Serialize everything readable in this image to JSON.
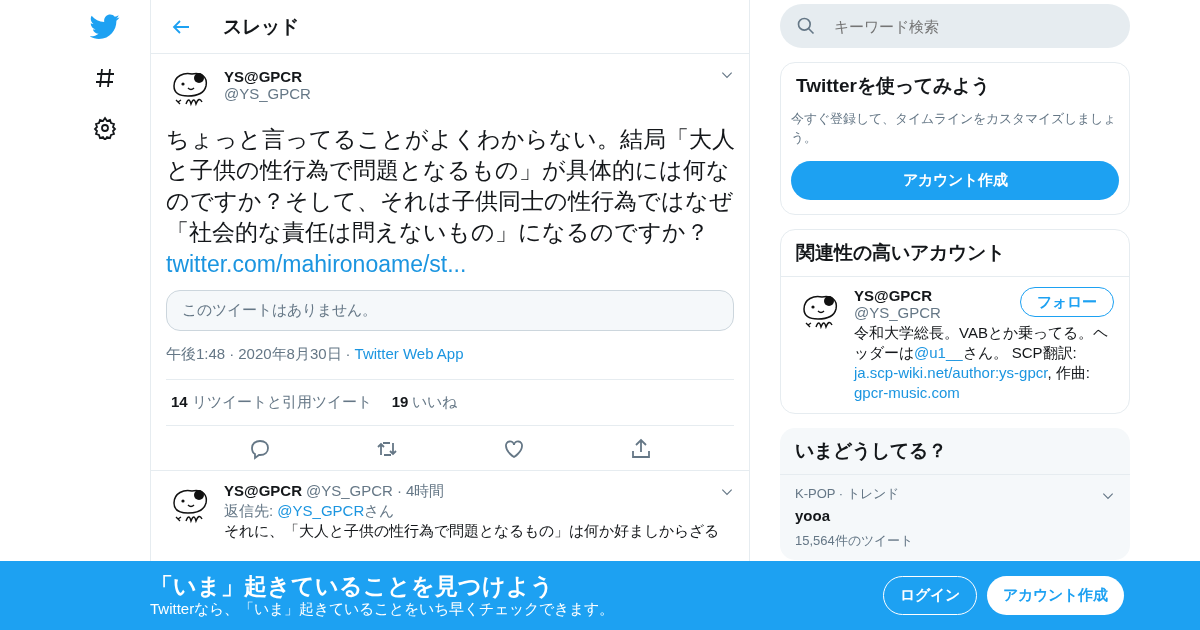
{
  "header": {
    "title": "スレッド"
  },
  "tweet": {
    "name": "YS@GPCR",
    "handle": "@YS_GPCR",
    "text": "ちょっと言ってることがよくわからない。結局「大人と子供の性行為で問題となるもの」が具体的には何なのですか？そして、それは子供同士の性行為ではなぜ「社会的な責任は問えないもの」になるのですか？",
    "link": "twitter.com/mahironoame/st...",
    "quote_notice": "このツイートはありません。",
    "time": "午後1:48",
    "separator_1": "·",
    "date": "2020年8月30日",
    "separator_2": "·",
    "source": "Twitter Web App",
    "stats": [
      {
        "count": "14",
        "label": "リツイートと引用ツイート"
      },
      {
        "count": "19",
        "label": "いいね"
      }
    ]
  },
  "reply": {
    "name": "YS@GPCR",
    "handle": "@YS_GPCR",
    "separator": "·",
    "time": "4時間",
    "reply_label": "返信先:",
    "reply_to": "@YS_GPCR",
    "reply_suffix": "さん",
    "text": "それに、「大人と子供の性行為で問題となるもの」は何か好ましからざる"
  },
  "search": {
    "placeholder": "キーワード検索"
  },
  "signup_card": {
    "title": "Twitterを使ってみよう",
    "text": "今すぐ登録して、タイムラインをカスタマイズしましょう。",
    "button": "アカウント作成"
  },
  "related": {
    "title": "関連性の高いアカウント",
    "accounts": [
      {
        "name": "YS@GPCR",
        "handle": "@YS_GPCR",
        "follow": "フォロー",
        "bio": [
          {
            "kind": "text",
            "text": "令和大学総長。VABとか乗ってる。ヘッダーは"
          },
          {
            "kind": "link",
            "text": "@u1__"
          },
          {
            "kind": "text",
            "text": "さん。 SCP翻訳: "
          },
          {
            "kind": "link",
            "text": "ja.scp-wiki.net/author:ys-gpcr"
          },
          {
            "kind": "text",
            "text": ", 作曲: "
          },
          {
            "kind": "link",
            "text": "gpcr-music.com"
          }
        ]
      }
    ]
  },
  "trends": {
    "title": "いまどうしてる？",
    "items": [
      {
        "context": "K-POP · トレンド",
        "name": "yooa",
        "count": "15,564件のツイート"
      }
    ]
  },
  "banner": {
    "title": "「いま」起きていることを見つけよう",
    "subtitle": "Twitterなら、「いま」起きていることをいち早くチェックできます。",
    "login": "ログイン",
    "signup": "アカウント作成"
  }
}
